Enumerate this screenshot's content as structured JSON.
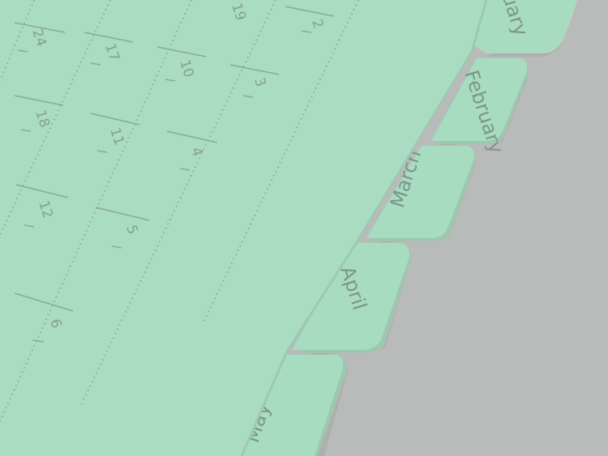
{
  "tabs": [
    {
      "label": "January"
    },
    {
      "label": "February"
    },
    {
      "label": "March"
    },
    {
      "label": "April"
    },
    {
      "label": "May"
    }
  ],
  "calendar": {
    "dates": [
      "19",
      "2",
      "24",
      "17",
      "10",
      "3",
      "18",
      "11",
      "4",
      "12",
      "5",
      "6"
    ]
  },
  "colors": {
    "background": "#b9bbba",
    "paper": "#a9dcc0",
    "print": "#7d9588"
  }
}
